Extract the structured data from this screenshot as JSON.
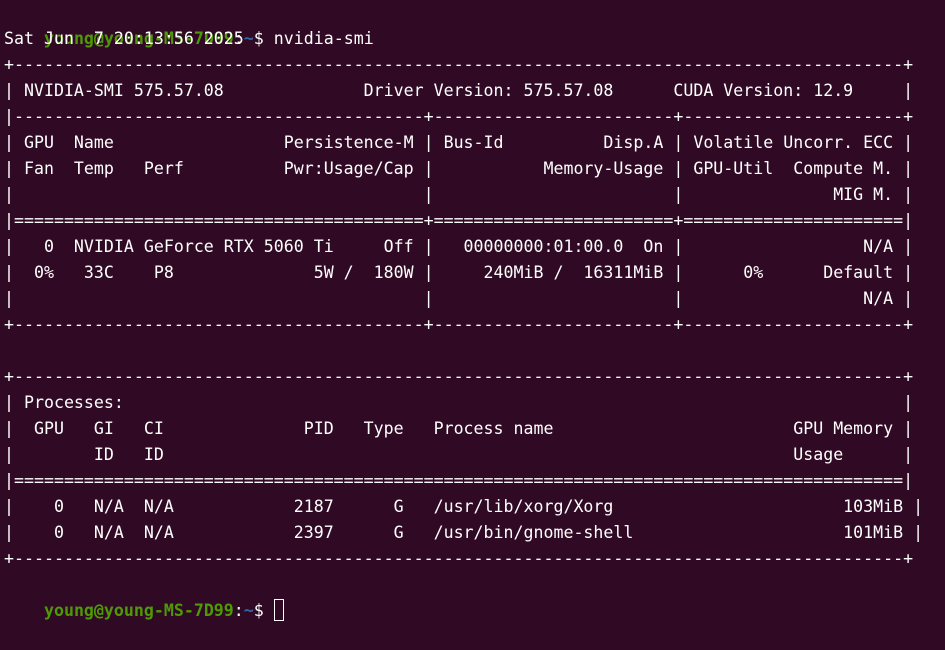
{
  "theme": {
    "background": "#300a24",
    "foreground": "#ffffff",
    "prompt_user_color": "#4e9a06",
    "prompt_path_color": "#3465a4"
  },
  "prompt": {
    "user_host": "young@young-MS-7D99",
    "colon": ":",
    "path": "~",
    "dollar": "$ "
  },
  "command": "nvidia-smi",
  "timestamp": "Sat Jun  7 20:13:56 2025",
  "gpu_table": [
    "+-----------------------------------------------------------------------------------------+",
    "| NVIDIA-SMI 575.57.08              Driver Version: 575.57.08      CUDA Version: 12.9     |",
    "|-----------------------------------------+------------------------+----------------------+",
    "| GPU  Name                 Persistence-M | Bus-Id          Disp.A | Volatile Uncorr. ECC |",
    "| Fan  Temp   Perf          Pwr:Usage/Cap |           Memory-Usage | GPU-Util  Compute M. |",
    "|                                         |                        |               MIG M. |",
    "|=========================================+========================+======================|",
    "|   0  NVIDIA GeForce RTX 5060 Ti     Off |   00000000:01:00.0  On |                  N/A |",
    "|  0%   33C    P8              5W /  180W |     240MiB /  16311MiB |      0%      Default |",
    "|                                         |                        |                  N/A |",
    "+-----------------------------------------+------------------------+----------------------+"
  ],
  "process_table": [
    "+-----------------------------------------------------------------------------------------+",
    "| Processes:                                                                              |",
    "|  GPU   GI   CI              PID   Type   Process name                        GPU Memory |",
    "|        ID   ID                                                               Usage      |",
    "|=========================================================================================|",
    "|    0   N/A  N/A            2187      G   /usr/lib/xorg/Xorg                       103MiB |",
    "|    0   N/A  N/A            2397      G   /usr/bin/gnome-shell                     101MiB |",
    "+-----------------------------------------------------------------------------------------+"
  ]
}
